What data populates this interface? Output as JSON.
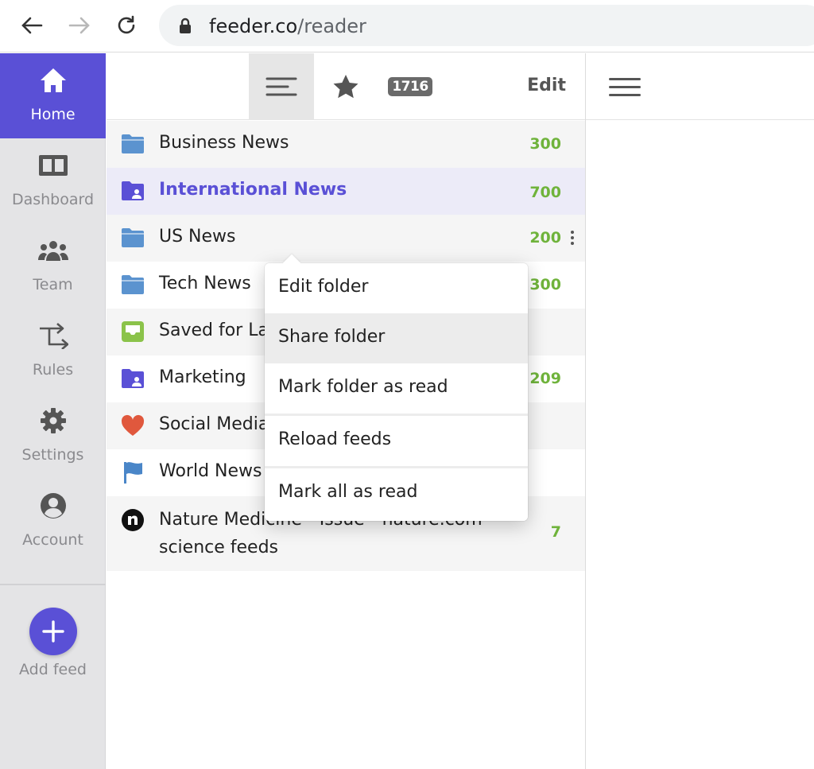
{
  "browser": {
    "url_host": "feeder.co",
    "url_path": "/reader"
  },
  "sidebar": {
    "items": [
      {
        "label": "Home",
        "icon": "home-icon",
        "active": true
      },
      {
        "label": "Dashboard",
        "icon": "dashboard-icon"
      },
      {
        "label": "Team",
        "icon": "team-icon"
      },
      {
        "label": "Rules",
        "icon": "rules-icon"
      },
      {
        "label": "Settings",
        "icon": "gear-icon"
      },
      {
        "label": "Account",
        "icon": "account-icon"
      }
    ],
    "add_label": "Add feed"
  },
  "toolbar": {
    "unread_count": "1716",
    "edit_label": "Edit"
  },
  "feeds": [
    {
      "name": "Business News",
      "count": "300",
      "icon": "folder-icon"
    },
    {
      "name": "International News",
      "count": "700",
      "icon": "shared-folder-icon"
    },
    {
      "name": "US News",
      "count": "200",
      "icon": "folder-icon"
    },
    {
      "name": "Tech News",
      "count": "300",
      "icon": "folder-icon"
    },
    {
      "name": "Saved for La",
      "count": "",
      "icon": "inbox-icon"
    },
    {
      "name": "Marketing",
      "count": "209",
      "icon": "shared-folder-icon"
    },
    {
      "name": "Social Media",
      "count": "",
      "icon": "heart-icon"
    },
    {
      "name": "World News",
      "count": "",
      "icon": "flag-icon"
    },
    {
      "name": "Nature Medicine - Issue - nature.com science feeds",
      "count": "7",
      "icon": "nature-logo-icon"
    }
  ],
  "context_menu": {
    "items": [
      "Edit folder",
      "Share folder",
      "Mark folder as read",
      "Reload feeds",
      "Mark all as read"
    ]
  },
  "colors": {
    "accent": "#5a50d6",
    "count_green": "#6fb33b",
    "folder_blue": "#5b93cf",
    "saved_green": "#8bc34a",
    "heart_red": "#e0583d"
  }
}
